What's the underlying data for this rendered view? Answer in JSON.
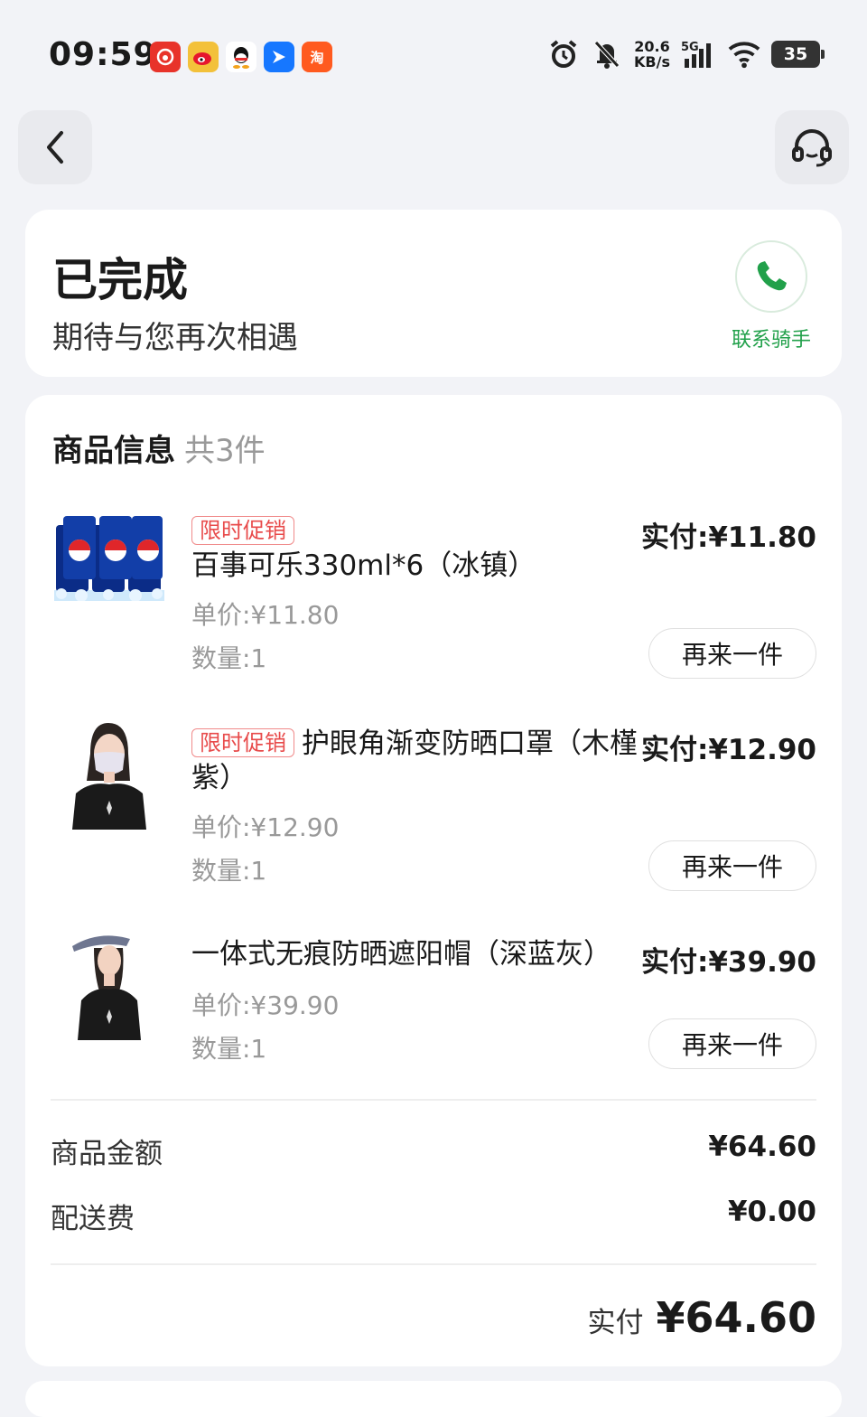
{
  "status_bar": {
    "time": "09:59",
    "net_speed_value": "20.6",
    "net_speed_unit": "KB/s",
    "network": "5G",
    "battery": "35",
    "app_icons": [
      "netease-music-icon",
      "weibo-icon",
      "qq-icon",
      "feishu-icon",
      "taobao-icon"
    ],
    "taobao_label": "淘"
  },
  "header": {
    "back_icon": "chevron-left-icon",
    "service_icon": "headset-icon"
  },
  "order_status": {
    "title": "已完成",
    "subtitle": "期待与您再次相遇",
    "contact_label": "联系骑手",
    "contact_color": "#21a04a"
  },
  "goods": {
    "header": "商品信息",
    "count": "共3件",
    "items": [
      {
        "tag": "限时促销",
        "name": "百事可乐330ml*6（冰镇）",
        "pay": "实付:¥11.80",
        "unit_price": "单价:¥11.80",
        "quantity": "数量:1",
        "button": "再来一件"
      },
      {
        "tag": "限时促销",
        "name": "护眼角渐变防晒口罩（木槿紫）",
        "pay": "实付:¥12.90",
        "unit_price": "单价:¥12.90",
        "quantity": "数量:1",
        "button": "再来一件"
      },
      {
        "tag": "",
        "name": "一体式无痕防晒遮阳帽（深蓝灰）",
        "pay": "实付:¥39.90",
        "unit_price": "单价:¥39.90",
        "quantity": "数量:1",
        "button": "再来一件"
      }
    ]
  },
  "summary": {
    "goods_amount_label": "商品金额",
    "goods_amount": "¥64.60",
    "delivery_label": "配送费",
    "delivery": "¥0.00",
    "total_label": "实付",
    "total": "¥64.60"
  }
}
